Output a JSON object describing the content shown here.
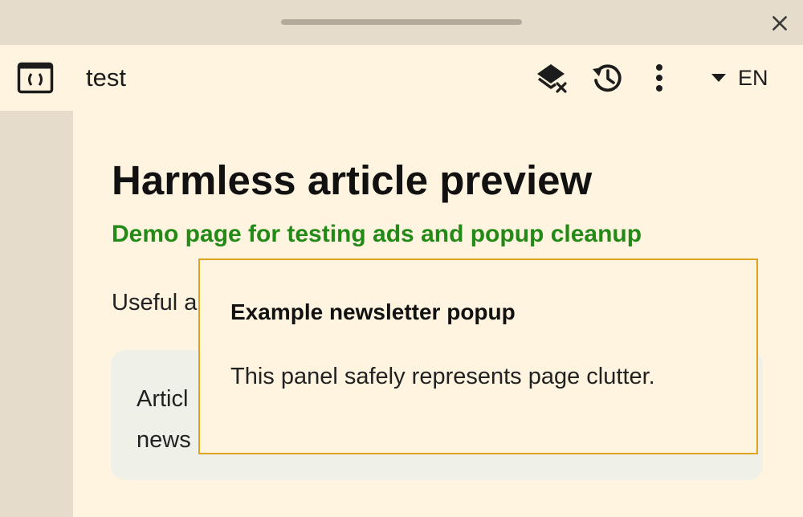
{
  "window": {
    "close_icon": "close-icon"
  },
  "toolbar": {
    "app_icon": "code-window-icon",
    "title": "test",
    "actions": [
      {
        "name": "clear-layers",
        "icon": "layers-clear-icon"
      },
      {
        "name": "history",
        "icon": "history-icon"
      },
      {
        "name": "more",
        "icon": "more-vert-icon"
      }
    ],
    "language": "EN"
  },
  "article": {
    "headline": "Harmless article preview",
    "subhead": "Demo page for testing ads and popup cleanup",
    "intro_visible": "Useful a",
    "card_line1_visible": "Articl",
    "card_line2_visible": "news"
  },
  "popup": {
    "title": "Example newsletter popup",
    "body": "This panel safely represents page clutter."
  },
  "colors": {
    "chrome": "#e6dccb",
    "page_bg": "#fff4df",
    "subhead_green": "#238a17",
    "popup_border": "#e0a21f",
    "card_bg": "#eff1e8"
  }
}
